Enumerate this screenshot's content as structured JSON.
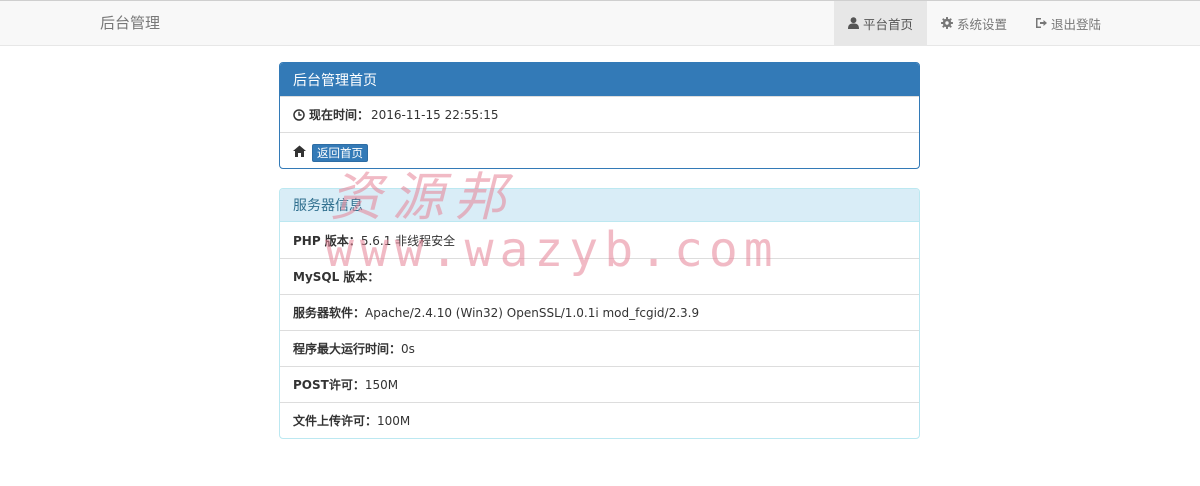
{
  "navbar": {
    "brand": "后台管理",
    "items": [
      {
        "label": "平台首页",
        "icon": "user-icon",
        "active": true
      },
      {
        "label": "系统设置",
        "icon": "gear-icon",
        "active": false
      },
      {
        "label": "退出登陆",
        "icon": "logout-icon",
        "active": false
      }
    ]
  },
  "home_panel": {
    "title": "后台管理首页",
    "time_label": "现在时间：",
    "time_value": "2016-11-15 22:55:15",
    "back_button": "返回首页"
  },
  "server_panel": {
    "title": "服务器信息",
    "rows": [
      {
        "label": "PHP 版本：",
        "value": "5.6.1 非线程安全"
      },
      {
        "label": "MySQL 版本：",
        "value": ""
      },
      {
        "label": "服务器软件：",
        "value": "Apache/2.4.10 (Win32) OpenSSL/1.0.1i mod_fcgid/2.3.9"
      },
      {
        "label": "程序最大运行时间：",
        "value": "0s"
      },
      {
        "label": "POST许可：",
        "value": "150M"
      },
      {
        "label": "文件上传许可：",
        "value": "100M"
      }
    ]
  },
  "watermark": {
    "cn": "资源邦",
    "url": "www.wazyb.com"
  },
  "colors": {
    "primary": "#337ab7",
    "info_bg": "#d9edf7",
    "info_text": "#31708f",
    "nav_bg": "#f8f8f8"
  }
}
